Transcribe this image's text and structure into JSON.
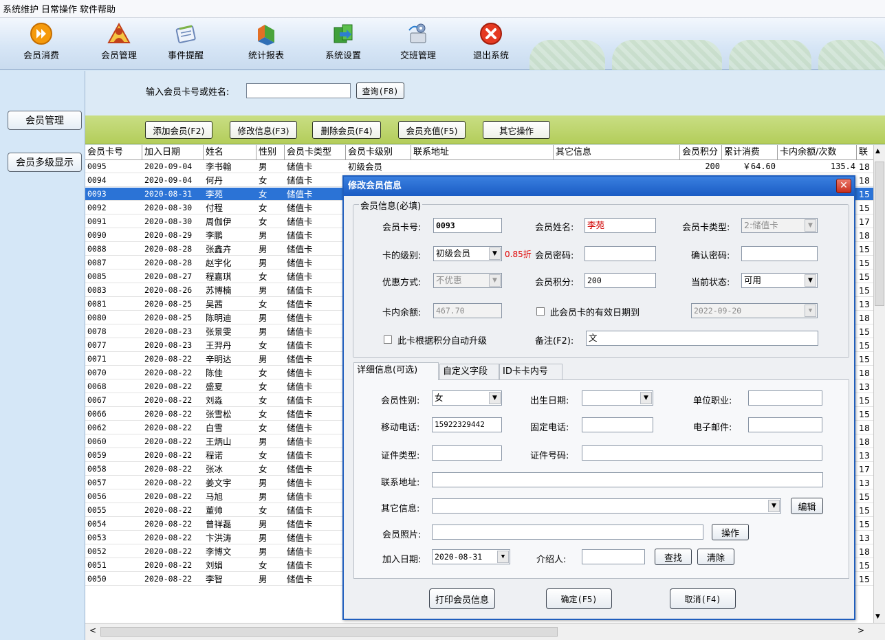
{
  "menu": [
    "系统维护",
    "日常操作",
    "软件帮助"
  ],
  "toolbar": [
    {
      "label": "会员消费",
      "icon": "fast-forward-icon"
    },
    {
      "label": "会员管理",
      "icon": "members-icon"
    },
    {
      "label": "事件提醒",
      "icon": "notebook-icon"
    },
    {
      "label": "统计报表",
      "icon": "chart-icon"
    },
    {
      "label": "系统设置",
      "icon": "settings-box-icon"
    },
    {
      "label": "交班管理",
      "icon": "shift-handover-icon"
    },
    {
      "label": "退出系统",
      "icon": "exit-icon"
    }
  ],
  "left": {
    "member_manage": "会员管理",
    "multi_level": "会员多级显示"
  },
  "search": {
    "label": "输入会员卡号或姓名:",
    "value": "",
    "button": "查询(F8)"
  },
  "actions": [
    "添加会员(F2)",
    "修改信息(F3)",
    "删除会员(F4)",
    "会员充值(F5)",
    "其它操作"
  ],
  "grid": {
    "headers": [
      "会员卡号",
      "加入日期",
      "姓名",
      "性别",
      "会员卡类型",
      "会员卡级别",
      "联系地址",
      "其它信息",
      "会员积分",
      "累计消费",
      "卡内余额/次数",
      "联"
    ],
    "first_row_extra": {
      "level": "初级会员",
      "points": "200",
      "consume": "￥64.60",
      "balance": "135.4"
    },
    "rows": [
      {
        "code": "0095",
        "date": "2020-09-04",
        "name": "李书翰",
        "sex": "男",
        "type": "储值卡",
        "tail": "18"
      },
      {
        "code": "0094",
        "date": "2020-09-04",
        "name": "何丹",
        "sex": "女",
        "type": "储值卡",
        "tail": "18"
      },
      {
        "code": "0093",
        "date": "2020-08-31",
        "name": "李苑",
        "sex": "女",
        "type": "储值卡",
        "tail": "15"
      },
      {
        "code": "0092",
        "date": "2020-08-30",
        "name": "付程",
        "sex": "女",
        "type": "储值卡",
        "tail": "15"
      },
      {
        "code": "0091",
        "date": "2020-08-30",
        "name": "周伽伊",
        "sex": "女",
        "type": "储值卡",
        "tail": "17"
      },
      {
        "code": "0090",
        "date": "2020-08-29",
        "name": "李鹏",
        "sex": "男",
        "type": "储值卡",
        "tail": "18"
      },
      {
        "code": "0088",
        "date": "2020-08-28",
        "name": "张鑫卉",
        "sex": "男",
        "type": "储值卡",
        "tail": "15"
      },
      {
        "code": "0087",
        "date": "2020-08-28",
        "name": "赵宇化",
        "sex": "男",
        "type": "储值卡",
        "tail": "15"
      },
      {
        "code": "0085",
        "date": "2020-08-27",
        "name": "程嘉琪",
        "sex": "女",
        "type": "储值卡",
        "tail": "15"
      },
      {
        "code": "0083",
        "date": "2020-08-26",
        "name": "苏博楠",
        "sex": "男",
        "type": "储值卡",
        "tail": "15"
      },
      {
        "code": "0081",
        "date": "2020-08-25",
        "name": "吴茜",
        "sex": "女",
        "type": "储值卡",
        "tail": "13"
      },
      {
        "code": "0080",
        "date": "2020-08-25",
        "name": "陈明迪",
        "sex": "男",
        "type": "储值卡",
        "tail": "18"
      },
      {
        "code": "0078",
        "date": "2020-08-23",
        "name": "张景雯",
        "sex": "男",
        "type": "储值卡",
        "tail": "15"
      },
      {
        "code": "0077",
        "date": "2020-08-23",
        "name": "王羿丹",
        "sex": "女",
        "type": "储值卡",
        "tail": "15"
      },
      {
        "code": "0071",
        "date": "2020-08-22",
        "name": "辛明达",
        "sex": "男",
        "type": "储值卡",
        "tail": "15"
      },
      {
        "code": "0070",
        "date": "2020-08-22",
        "name": "陈佳",
        "sex": "女",
        "type": "储值卡",
        "tail": "18"
      },
      {
        "code": "0068",
        "date": "2020-08-22",
        "name": "盛夏",
        "sex": "女",
        "type": "储值卡",
        "tail": "13"
      },
      {
        "code": "0067",
        "date": "2020-08-22",
        "name": "刘淼",
        "sex": "女",
        "type": "储值卡",
        "tail": "15"
      },
      {
        "code": "0066",
        "date": "2020-08-22",
        "name": "张雪松",
        "sex": "女",
        "type": "储值卡",
        "tail": "15"
      },
      {
        "code": "0062",
        "date": "2020-08-22",
        "name": "白雪",
        "sex": "女",
        "type": "储值卡",
        "tail": "18"
      },
      {
        "code": "0060",
        "date": "2020-08-22",
        "name": "王炳山",
        "sex": "男",
        "type": "储值卡",
        "tail": "18"
      },
      {
        "code": "0059",
        "date": "2020-08-22",
        "name": "程诺",
        "sex": "女",
        "type": "储值卡",
        "tail": "13"
      },
      {
        "code": "0058",
        "date": "2020-08-22",
        "name": "张冰",
        "sex": "女",
        "type": "储值卡",
        "tail": "17"
      },
      {
        "code": "0057",
        "date": "2020-08-22",
        "name": "姜文宇",
        "sex": "男",
        "type": "储值卡",
        "tail": "13"
      },
      {
        "code": "0056",
        "date": "2020-08-22",
        "name": "马旭",
        "sex": "男",
        "type": "储值卡",
        "tail": "15"
      },
      {
        "code": "0055",
        "date": "2020-08-22",
        "name": "董帅",
        "sex": "女",
        "type": "储值卡",
        "tail": "15"
      },
      {
        "code": "0054",
        "date": "2020-08-22",
        "name": "曾祥磊",
        "sex": "男",
        "type": "储值卡",
        "tail": "15"
      },
      {
        "code": "0053",
        "date": "2020-08-22",
        "name": "卞洪涛",
        "sex": "男",
        "type": "储值卡",
        "tail": "13"
      },
      {
        "code": "0052",
        "date": "2020-08-22",
        "name": "李博文",
        "sex": "男",
        "type": "储值卡",
        "tail": "18"
      },
      {
        "code": "0051",
        "date": "2020-08-22",
        "name": "刘娟",
        "sex": "女",
        "type": "储值卡",
        "tail": "15"
      },
      {
        "code": "0050",
        "date": "2020-08-22",
        "name": "李智",
        "sex": "男",
        "type": "储值卡",
        "tail": "15"
      }
    ]
  },
  "dialog": {
    "title": "修改会员信息",
    "required_group": "会员信息(必填)",
    "card_no_label": "会员卡号:",
    "card_no": "0093",
    "name_label": "会员姓名:",
    "name": "李苑",
    "card_type_label": "会员卡类型:",
    "card_type": "2:储值卡",
    "level_label": "卡的级别:",
    "level": "初级会员",
    "discount": "0.85折",
    "password_label": "会员密码:",
    "password": "",
    "confirm_label": "确认密码:",
    "confirm": "",
    "promo_label": "优惠方式:",
    "promo": "不优惠",
    "points_label": "会员积分:",
    "points": "200",
    "status_label": "当前状态:",
    "status": "可用",
    "balance_label": "卡内余额:",
    "balance": "467.70",
    "expiry_check_label": "此会员卡的有效日期到",
    "expiry_date": "2022-09-20",
    "auto_upgrade_label": "此卡根据积分自动升级",
    "remark_label": "备注(F2):",
    "remark": "文",
    "tabs": [
      "详细信息(可选)",
      "自定义字段",
      "ID卡卡内号"
    ],
    "gender_label": "会员性别:",
    "gender": "女",
    "birth_label": "出生日期:",
    "birth": "",
    "job_label": "单位职业:",
    "job": "",
    "mobile_label": "移动电话:",
    "mobile": "15922329442",
    "phone_label": "固定电话:",
    "phone": "",
    "email_label": "电子邮件:",
    "email": "",
    "idtype_label": "证件类型:",
    "idtype": "",
    "idno_label": "证件号码:",
    "idno": "",
    "address_label": "联系地址:",
    "address": "",
    "other_label": "其它信息:",
    "other": "",
    "edit_button": "编辑",
    "photo_label": "会员照片:",
    "photo": "",
    "op_button": "操作",
    "join_label": "加入日期:",
    "join_date": "2020-08-31",
    "referrer_label": "介绍人:",
    "referrer": "",
    "find_button": "查找",
    "clear_button": "清除",
    "print_button": "打印会员信息",
    "ok_button": "确定(F5)",
    "cancel_button": "取消(F4)"
  },
  "colors": {
    "selection": "#2b73d6",
    "dialog_title": "#1a5bc4",
    "action_bar": "#b3cd5a",
    "discount": "#e00000"
  }
}
